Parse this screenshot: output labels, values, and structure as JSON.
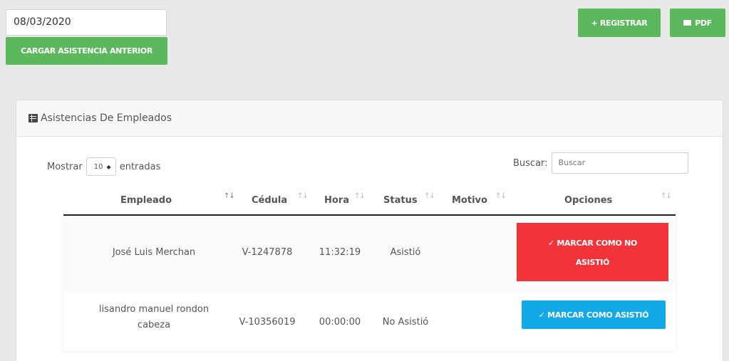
{
  "date_value": "08/03/2020",
  "buttons": {
    "cargar": "CARGAR ASISTENCIA ANTERIOR",
    "registrar": "+ REGISTRAR",
    "pdf": "PDF"
  },
  "card": {
    "title": "Asistencias De Empleados",
    "length_label_before": "Mostrar",
    "length_value": "10",
    "length_label_after": "entradas",
    "search_label": "Buscar:",
    "search_placeholder": "Buscar"
  },
  "table": {
    "columns": [
      "Empleado",
      "Cédula",
      "Hora",
      "Status",
      "Motivo",
      "Opciones"
    ],
    "rows": [
      {
        "empleado": "José Luis Merchan",
        "cedula": "V-1247878",
        "hora": "11:32:19",
        "status": "Asistió",
        "motivo": "",
        "action_line1": "✓ MARCAR COMO NO",
        "action_line2": "ASISTIÓ"
      },
      {
        "empleado_line1": "lisandro manuel rondon",
        "empleado_line2": "cabeza",
        "cedula": "V-10356019",
        "hora": "00:00:00",
        "status": "No Asistió",
        "motivo": "",
        "action": "✓ MARCAR COMO ASISTIÓ"
      }
    ]
  },
  "colors": {
    "green": "#5cb85c",
    "red": "#f2333a",
    "blue": "#13a9e7"
  },
  "icons": {
    "sort": "sort-icon",
    "list": "list-icon",
    "pdf": "pdf-icon",
    "check": "check-icon"
  }
}
